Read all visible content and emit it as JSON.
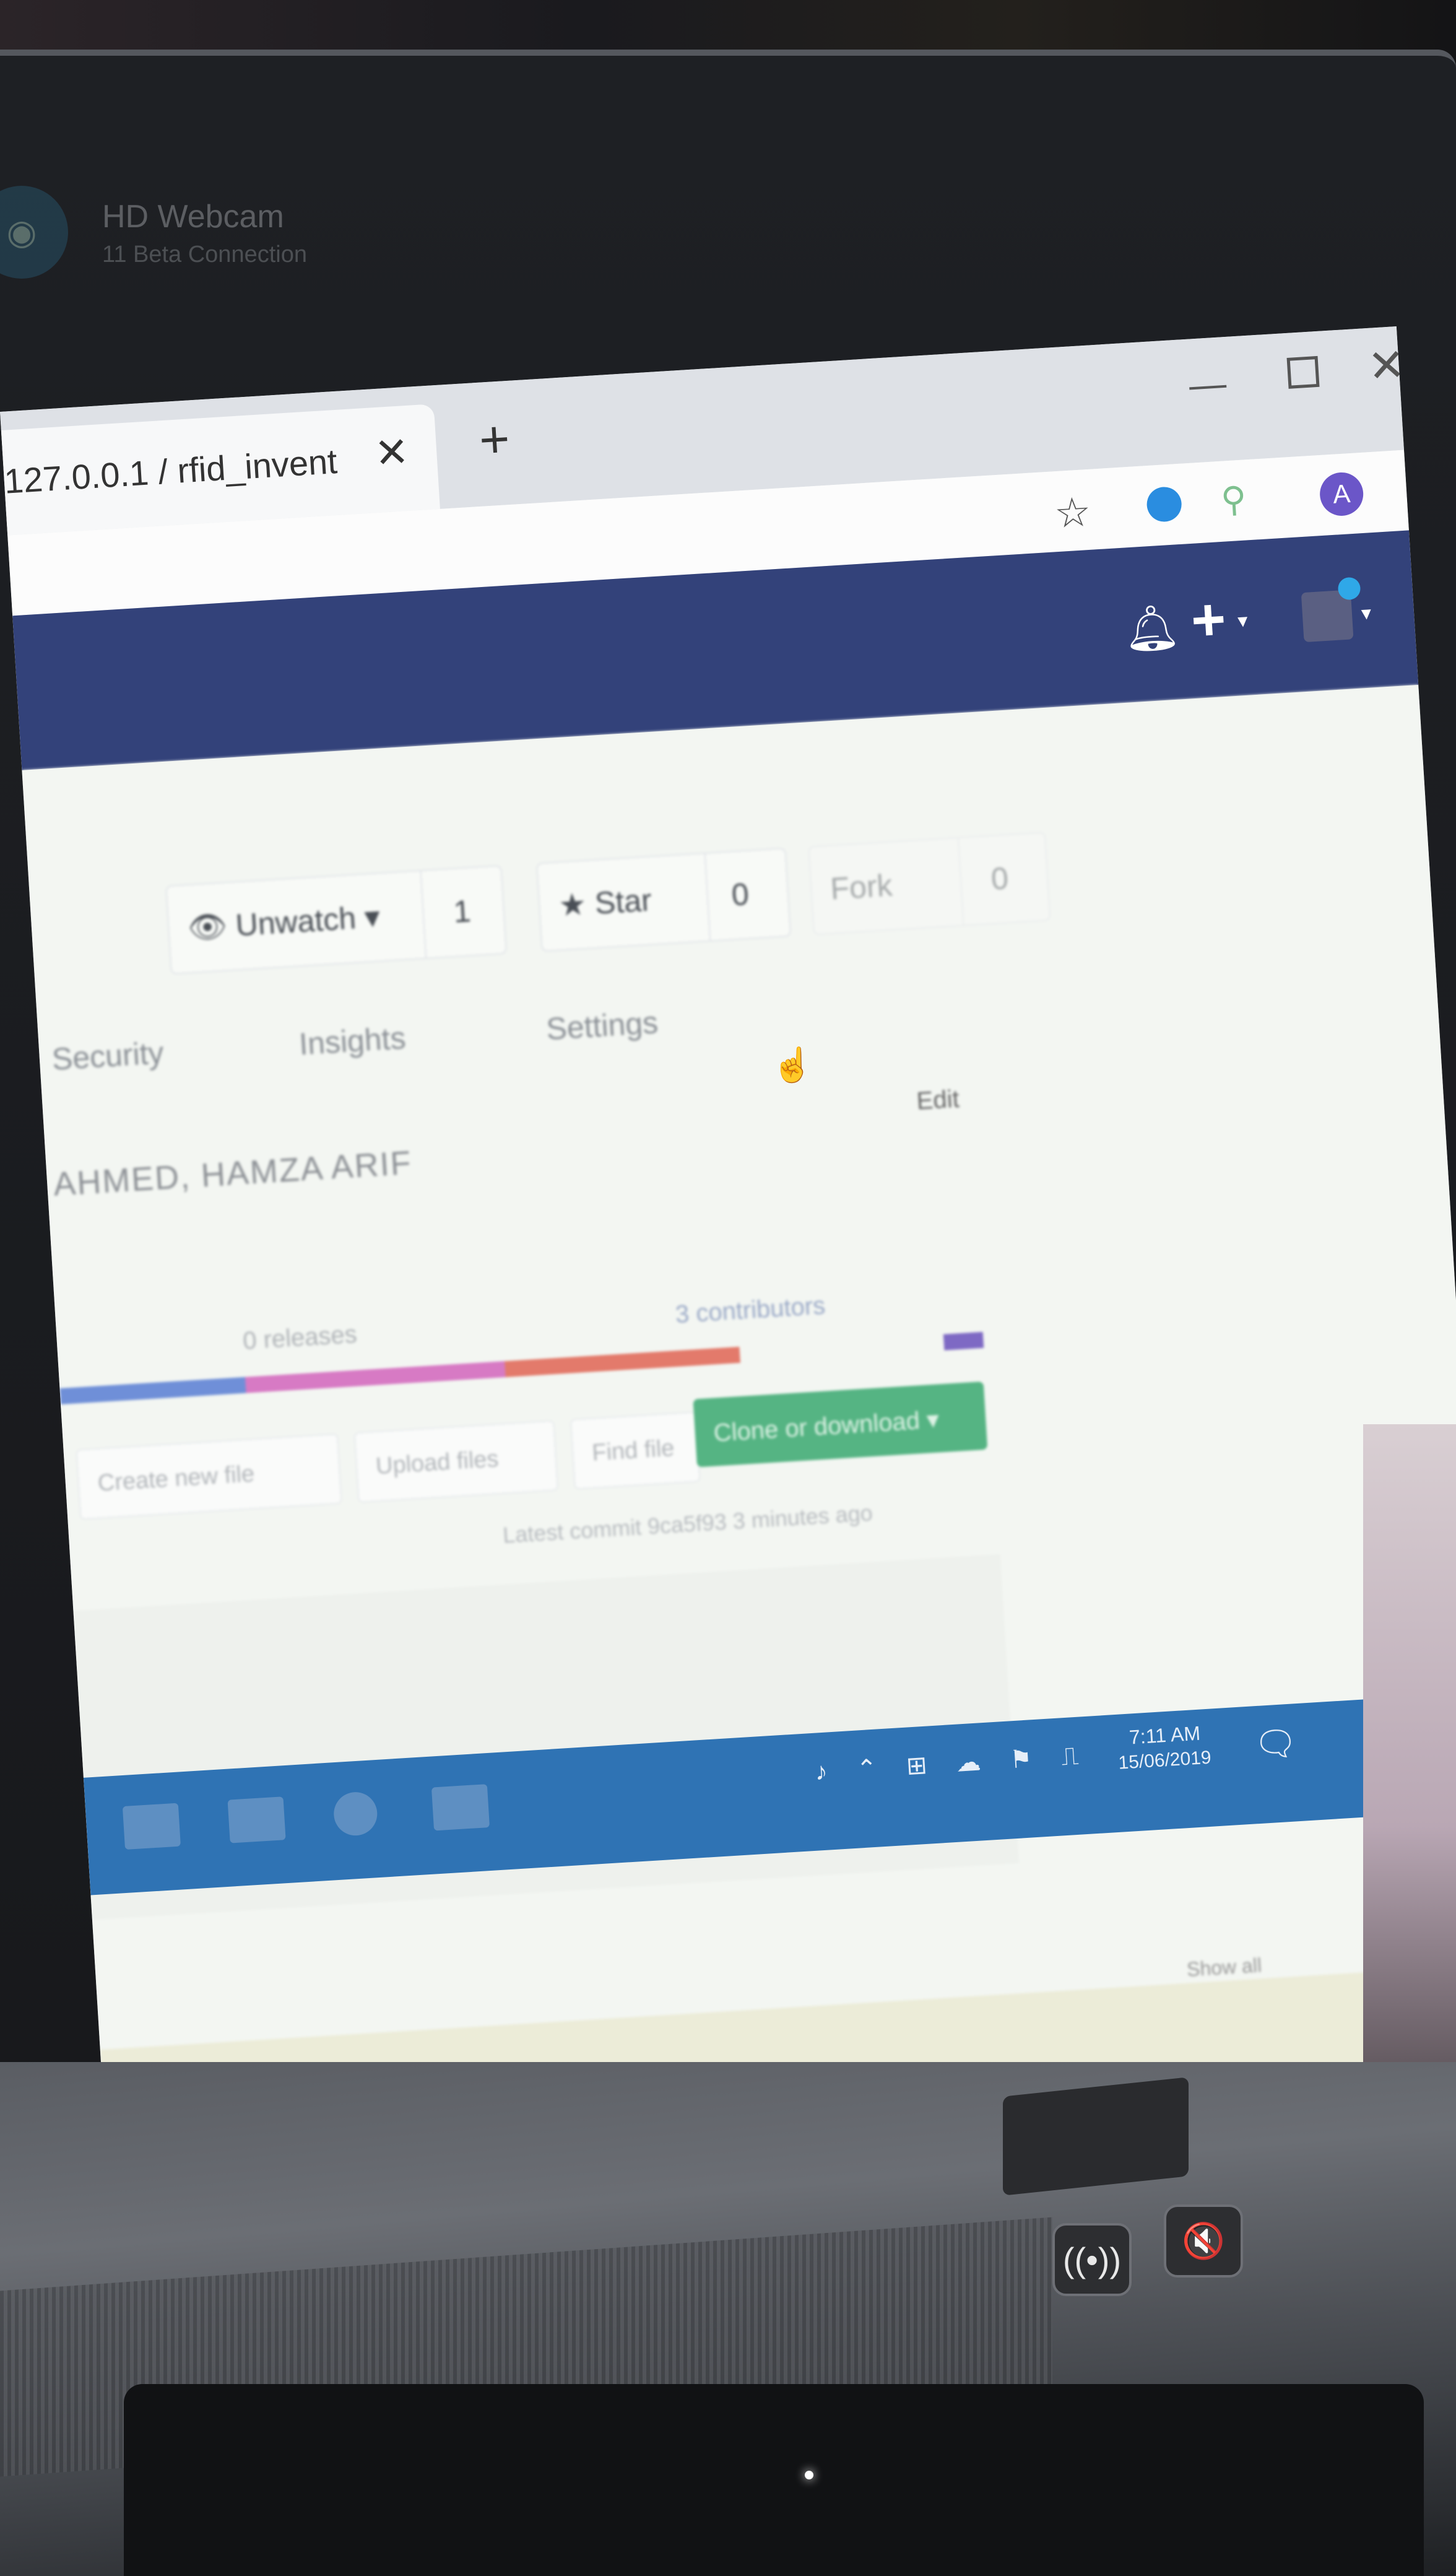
{
  "notification": {
    "title": "HD Webcam",
    "subtitle": "11 Beta Connection"
  },
  "browser": {
    "tab_title": "127.0.0.1 / rfid_invent",
    "tab_close": "✕",
    "new_tab": "+",
    "window_min": "—",
    "window_close": "✕",
    "profile_initial": "A"
  },
  "repo": {
    "unwatch_label": "Unwatch ▾",
    "unwatch_count": "1",
    "star_label": "★ Star",
    "star_count": "0",
    "fork_label": "Fork",
    "fork_count": "0",
    "tabs": [
      "Security",
      "Insights",
      "Settings"
    ],
    "description": "AHMED, HAMZA ARIF",
    "edit_label": "Edit",
    "releases": "0 releases",
    "contributors": "3 contributors",
    "buttons": {
      "create": "Create new file",
      "upload": "Upload files",
      "find": "Find file",
      "clone": "Clone or download ▾"
    },
    "latest_commit": "Latest commit 9ca5f93 3 minutes ago",
    "lang_colors": [
      "#6f8fd8",
      "#d77ac4",
      "#e37a6b",
      "#7e69c4"
    ]
  },
  "shelf": {
    "show_all": "Show all"
  },
  "taskbar": {
    "time": "7:11 AM",
    "date": "15/06/2019"
  },
  "keys": {
    "wifi": "((•))",
    "mute": "🔇"
  }
}
